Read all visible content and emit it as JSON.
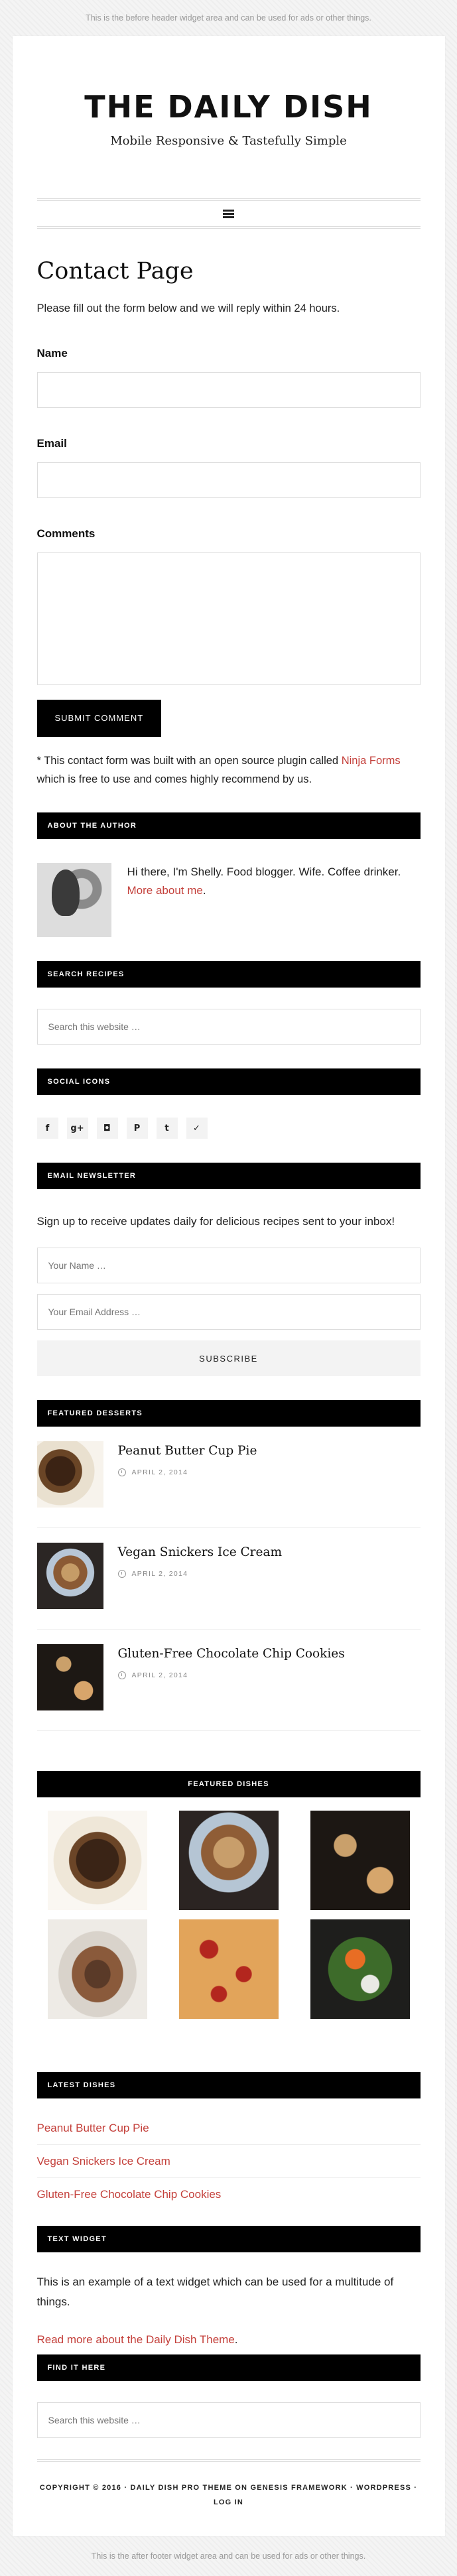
{
  "before_header": "This is the before header widget area and can be used for ads or other things.",
  "after_footer": "This is the after footer widget area and can be used for ads or other things.",
  "header": {
    "title": "THE DAILY DISH",
    "description": "Mobile Responsive & Tastefully Simple"
  },
  "nav": {
    "icon": "menu-icon"
  },
  "page": {
    "title": "Contact Page",
    "intro": "Please fill out the form below and we will reply within 24 hours.",
    "fields": {
      "name_label": "Name",
      "email_label": "Email",
      "comments_label": "Comments"
    },
    "submit_label": "SUBMIT COMMENT",
    "note_before": "* This contact form was built with an open source plugin called ",
    "note_link": "Ninja Forms",
    "note_after": " which is free to use and comes highly recommend by us."
  },
  "about": {
    "title": "ABOUT THE AUTHOR",
    "text": "Hi there, I'm Shelly. Food blogger. Wife. Coffee drinker.",
    "link": "More about me",
    "link_suffix": "."
  },
  "search_recipes": {
    "title": "SEARCH RECIPES",
    "placeholder": "Search this website …"
  },
  "social": {
    "title": "SOCIAL ICONS",
    "icons": [
      {
        "name": "facebook-icon",
        "glyph": "f"
      },
      {
        "name": "google-plus-icon",
        "glyph": "g+"
      },
      {
        "name": "instagram-icon",
        "glyph": "◘"
      },
      {
        "name": "pinterest-icon",
        "glyph": "P"
      },
      {
        "name": "tumblr-icon",
        "glyph": "t"
      },
      {
        "name": "twitter-icon",
        "glyph": "✓"
      }
    ]
  },
  "newsletter": {
    "title": "EMAIL NEWSLETTER",
    "text": "Sign up to receive updates daily for delicious recipes sent to your inbox!",
    "name_placeholder": "Your Name …",
    "email_placeholder": "Your Email Address …",
    "button": "SUBSCRIBE"
  },
  "featured_desserts": {
    "title": "FEATURED DESSERTS",
    "posts": [
      {
        "title": "Peanut Butter Cup Pie",
        "date": "APRIL 2, 2014"
      },
      {
        "title": "Vegan Snickers Ice Cream",
        "date": "APRIL 2, 2014"
      },
      {
        "title": "Gluten-Free Chocolate Chip Cookies",
        "date": "APRIL 2, 2014"
      }
    ]
  },
  "featured_dishes": {
    "title": "FEATURED DISHES"
  },
  "latest_dishes": {
    "title": "LATEST DISHES",
    "items": [
      "Peanut Butter Cup Pie",
      "Vegan Snickers Ice Cream",
      "Gluten-Free Chocolate Chip Cookies"
    ]
  },
  "text_widget": {
    "title": "TEXT WIDGET",
    "text": "This is an example of a text widget which can be used for a multitude of things.",
    "link": "Read more about the Daily Dish Theme",
    "link_suffix": "."
  },
  "find_it": {
    "title": "FIND IT HERE",
    "placeholder": "Search this website …"
  },
  "footer": {
    "line1": "COPYRIGHT © 2016 · DAILY DISH PRO THEME ON GENESIS FRAMEWORK · WORDPRESS · LOG IN"
  },
  "colors": {
    "accent": "#c4403b",
    "widget_bar": "#000000"
  }
}
